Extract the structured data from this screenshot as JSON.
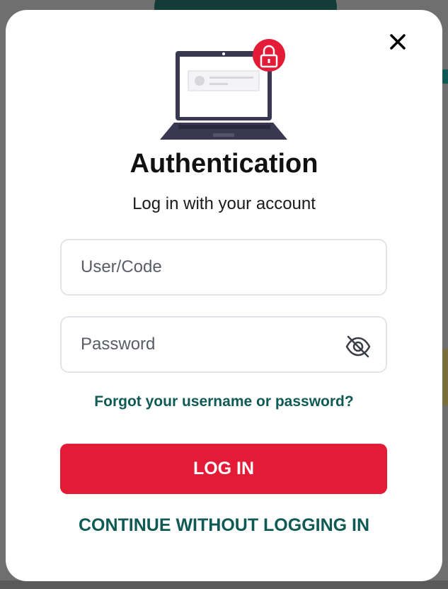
{
  "modal": {
    "title": "Authentication",
    "subtitle": "Log in with your account",
    "close_icon": "close-icon"
  },
  "form": {
    "user": {
      "placeholder": "User/Code",
      "value": ""
    },
    "password": {
      "placeholder": "Password",
      "value": ""
    },
    "visibility_icon": "eye-off-icon",
    "forgot_link": "Forgot your username or password?",
    "login_button": "LOG IN",
    "continue_link": "CONTINUE WITHOUT LOGGING IN"
  },
  "colors": {
    "accent_red": "#e31b37",
    "link_teal": "#0f5a54",
    "laptop_dark": "#3a3850"
  }
}
